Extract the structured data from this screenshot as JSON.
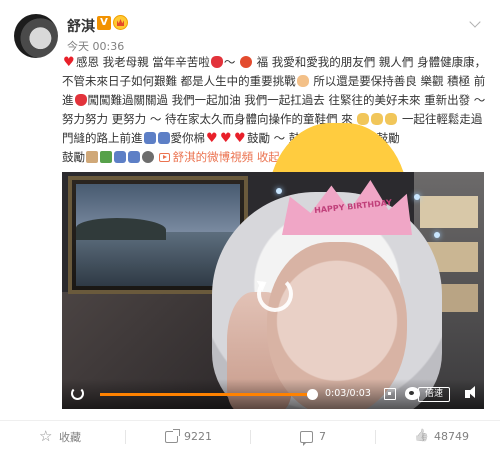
{
  "post": {
    "user_name": "舒淇",
    "verified_badge": "V",
    "time": "今天 00:36",
    "text_lines": [
      "感恩 我老母親 當年辛苦啦",
      "福 我愛和愛我的朋友們 親人們 身體健康康",
      "，不管未來日子如何艱難 都是人生中的重要挑戰",
      "所以還是要保持善良 樂觀 積極",
      "前進",
      "闖闖難過關關過 我們一起加油 我們一起扛過去 往緊往的美好未來 重新出發",
      "～ 努力努力 更努力",
      "～",
      "待在家太久而身體向操作的童鞋們 來",
      "一起",
      "往輕鬆走過門縫的路上前進",
      "愛你棉",
      "鼓勵 ～ 鼓勵鼓勵 ～ 鼓勵鼓勵",
      "鼓勵"
    ],
    "video_link_text": "舒淇的微博視頻",
    "collapse_text": "收起全文",
    "collapse_arrow": "∧"
  },
  "video": {
    "tiara_text": "HAPPY BIRTHDAY",
    "current_time": "0:03",
    "duration": "0:03",
    "time_separator": "/",
    "progress": 1.0,
    "speed_label": "倍速"
  },
  "toolbar": {
    "favorite_label": "收藏",
    "share_count": "9221",
    "comment_count": "7",
    "like_count": "48749"
  },
  "colors": {
    "accent": "#eb7350",
    "progress": "#ff8200",
    "badge": "#f29200"
  },
  "icons": [
    "heart-icon",
    "rose-icon",
    "muscle-icon",
    "replay-icon",
    "fullscreen-icon",
    "weibo-logo-icon",
    "volume-icon",
    "star-icon",
    "share-icon",
    "comment-icon",
    "like-icon",
    "chevron-down-icon"
  ]
}
